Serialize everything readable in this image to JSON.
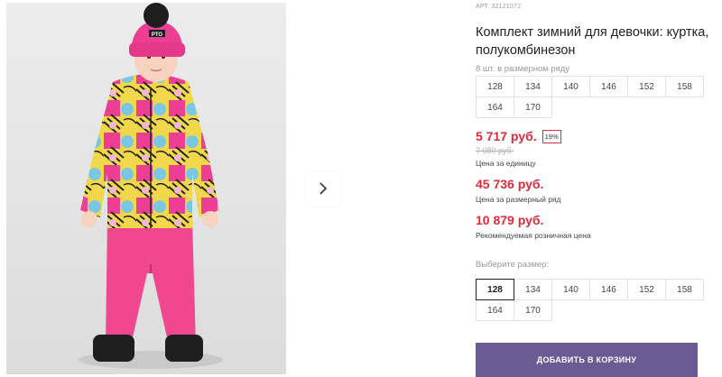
{
  "product": {
    "article": "АРТ. 32121072",
    "title": "Комплект зимний для девочки: куртка, полукомбинезон",
    "pack_note": "8 шт. в размерном ряду",
    "pack_sizes": [
      "128",
      "134",
      "140",
      "146",
      "152",
      "158",
      "164",
      "170"
    ],
    "price": "5 717 руб.",
    "discount": "19%",
    "old_price": "7 080 руб.",
    "unit_price_label": "Цена за единицу",
    "pack_price": "45 736 руб.",
    "pack_price_label": "Цена за размерный ряд",
    "retail_price": "10 879 руб.",
    "retail_price_label": "Рекомендуемая розничная цена",
    "choose_size_label": "Выберите размер:",
    "sizes": [
      "128",
      "134",
      "140",
      "146",
      "152",
      "158",
      "164",
      "170"
    ],
    "selected_size": "128",
    "add_to_cart": "ДОБАВИТЬ В КОРЗИНУ"
  },
  "gallery": {
    "hat_logo_text": "PTO",
    "next_icon": "chevron-right-icon"
  },
  "colors": {
    "accent": "#6b5b95",
    "price_red": "#e2283b",
    "jacket_pink": "#ec3f93",
    "pants_pink": "#f0478f"
  }
}
